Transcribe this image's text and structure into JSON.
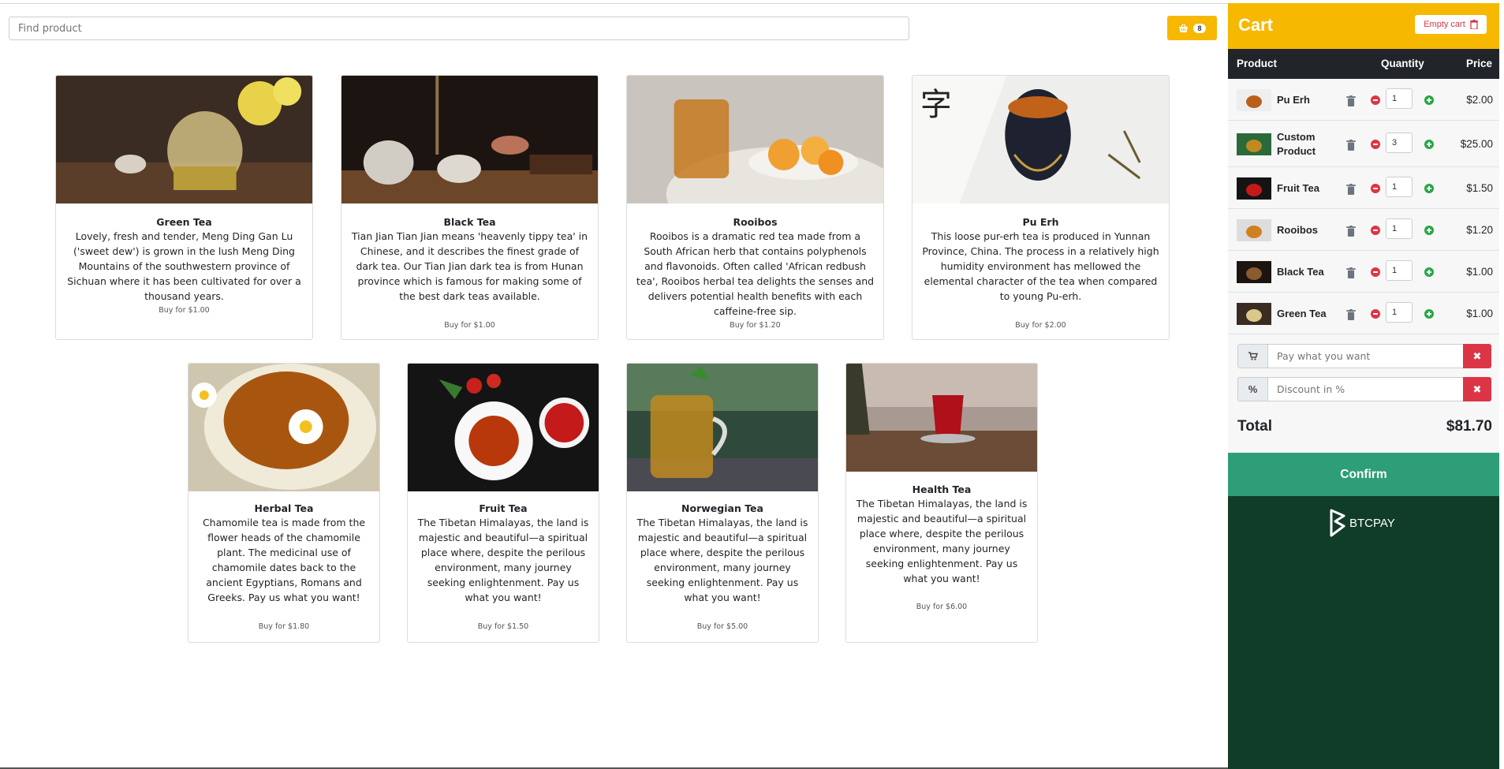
{
  "search": {
    "placeholder": "Find product"
  },
  "cart_button": {
    "count": "8",
    "icon": "basket-icon"
  },
  "products": [
    {
      "title": "Green Tea",
      "desc": "Lovely, fresh and tender, Meng Ding Gan Lu ('sweet dew') is grown in the lush Meng Ding Mountains of the southwestern province of Sichuan where it has been cultivated for over a thousand years.",
      "buy": "Buy for $1.00"
    },
    {
      "title": "Black Tea",
      "desc": "Tian Jian Tian Jian means 'heavenly tippy tea' in Chinese, and it describes the finest grade of dark tea. Our Tian Jian dark tea is from Hunan province which is famous for making some of the best dark teas available.",
      "buy": "Buy for $1.00"
    },
    {
      "title": "Rooibos",
      "desc": "Rooibos is a dramatic red tea made from a South African herb that contains polyphenols and flavonoids. Often called 'African redbush tea', Rooibos herbal tea delights the senses and delivers potential health benefits with each caffeine-free sip.",
      "buy": "Buy for $1.20"
    },
    {
      "title": "Pu Erh",
      "desc": "This loose pur-erh tea is produced in Yunnan Province, China. The process in a relatively high humidity environment has mellowed the elemental character of the tea when compared to young Pu-erh.",
      "buy": "Buy for $2.00"
    },
    {
      "title": "Herbal Tea",
      "desc": "Chamomile tea is made from the flower heads of the chamomile plant. The medicinal use of chamomile dates back to the ancient Egyptians, Romans and Greeks. Pay us what you want!",
      "buy": "Buy for $1.80"
    },
    {
      "title": "Fruit Tea",
      "desc": "The Tibetan Himalayas, the land is majestic and beautiful—a spiritual place where, despite the perilous environment, many journey seeking enlightenment. Pay us what you want!",
      "buy": "Buy for $1.50"
    },
    {
      "title": "Norwegian Tea",
      "desc": "The Tibetan Himalayas, the land is majestic and beautiful—a spiritual place where, despite the perilous environment, many journey seeking enlightenment. Pay us what you want!",
      "buy": "Buy for $5.00"
    },
    {
      "title": "Health Tea",
      "desc": "The Tibetan Himalayas, the land is majestic and beautiful—a spiritual place where, despite the perilous environment, many journey seeking enlightenment. Pay us what you want!",
      "buy": "Buy for $6.00"
    }
  ],
  "cart": {
    "title": "Cart",
    "empty_label": "Empty cart",
    "headers": {
      "product": "Product",
      "quantity": "Quantity",
      "price": "Price"
    },
    "items": [
      {
        "name": "Pu Erh",
        "qty": "1",
        "price": "$2.00"
      },
      {
        "name": "Custom Product",
        "qty": "3",
        "price": "$25.00"
      },
      {
        "name": "Fruit Tea",
        "qty": "1",
        "price": "$1.50"
      },
      {
        "name": "Rooibos",
        "qty": "1",
        "price": "$1.20"
      },
      {
        "name": "Black Tea",
        "qty": "1",
        "price": "$1.00"
      },
      {
        "name": "Green Tea",
        "qty": "1",
        "price": "$1.00"
      }
    ],
    "tip_placeholder": "Pay what you want",
    "discount_prefix": "%",
    "discount_placeholder": "Discount in %",
    "total_label": "Total",
    "total_value": "$81.70",
    "confirm_label": "Confirm",
    "brand": "BTCPAY"
  },
  "colors": {
    "accent": "#f6b800",
    "confirm": "#2e9e78",
    "footer": "#103d28",
    "danger": "#dc3545",
    "success": "#28a745"
  }
}
